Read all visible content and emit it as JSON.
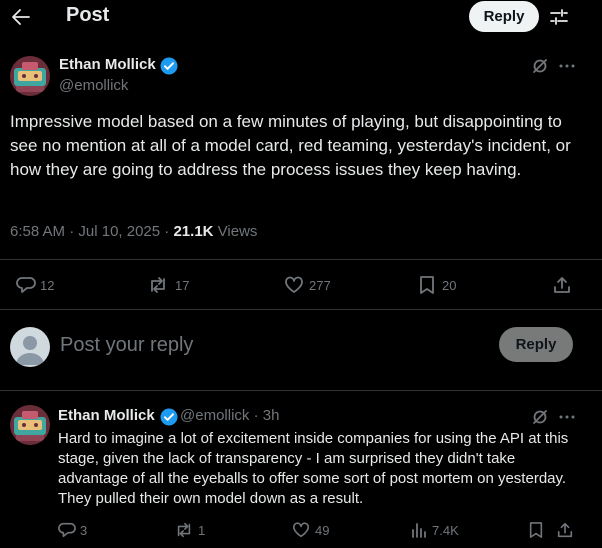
{
  "header": {
    "title": "Post",
    "reply_button": "Reply",
    "back_icon": "arrow-left-icon",
    "filter_icon": "sliders-icon"
  },
  "main_post": {
    "author_name": "Ethan Mollick",
    "handle": "@emollick",
    "text": "Impressive model based on a few minutes of playing, but disappointing to see no mention at all of a model card, red teaming, yesterday's incident, or how they are going to address the process issues they keep having.",
    "time": "6:58 AM",
    "date": "Jul 10, 2025",
    "separator": "·",
    "views_count": "21.1K",
    "views_label": "Views",
    "actions": {
      "replies": "12",
      "reposts": "17",
      "likes": "277",
      "bookmarks": "20"
    }
  },
  "reply_box": {
    "placeholder": "Post your reply",
    "button": "Reply"
  },
  "reply_post": {
    "author_name": "Ethan Mollick",
    "handle_time": "@emollick · 3h",
    "text": "Hard to imagine a lot of excitement inside companies for using the API at this stage, given the lack of transparency - I am surprised they didn't take advantage of all the eyeballs to offer some sort of post mortem on yesterday. They pulled their own model down as a result.",
    "actions": {
      "replies": "3",
      "reposts": "1",
      "likes": "49",
      "views": "7.4K"
    }
  },
  "colors": {
    "background": "#000000",
    "text": "#e7e9ea",
    "muted": "#71767b",
    "verified": "#1d9bf0",
    "divider": "#2f3336"
  }
}
